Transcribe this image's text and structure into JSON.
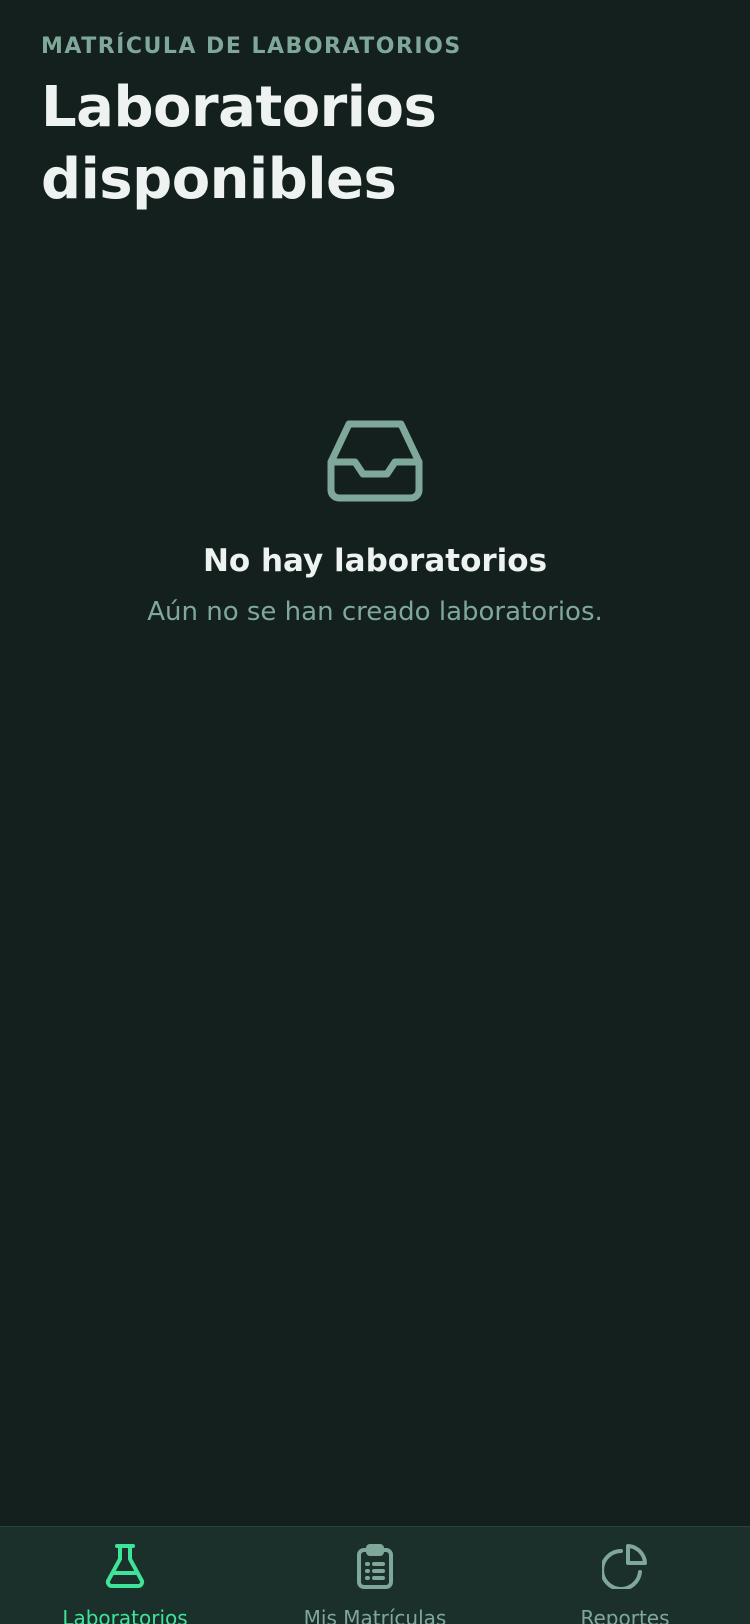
{
  "header": {
    "eyebrow": "MATRÍCULA DE LABORATORIOS",
    "title": "Laboratorios disponibles"
  },
  "empty_state": {
    "icon": "inbox-icon",
    "title": "No hay laboratorios",
    "subtitle": "Aún no se han creado laboratorios."
  },
  "tabbar": {
    "tabs": [
      {
        "label": "Laboratorios",
        "icon": "flask-icon",
        "active": true
      },
      {
        "label": "Mis Matrículas",
        "icon": "clipboard-icon",
        "active": false
      },
      {
        "label": "Reportes",
        "icon": "pie-chart-icon",
        "active": false
      }
    ]
  },
  "colors": {
    "background": "#13201d",
    "tabbar_background": "#1c302b",
    "accent": "#3ee49a",
    "muted": "#7fa79a",
    "text": "#eef3f1"
  }
}
